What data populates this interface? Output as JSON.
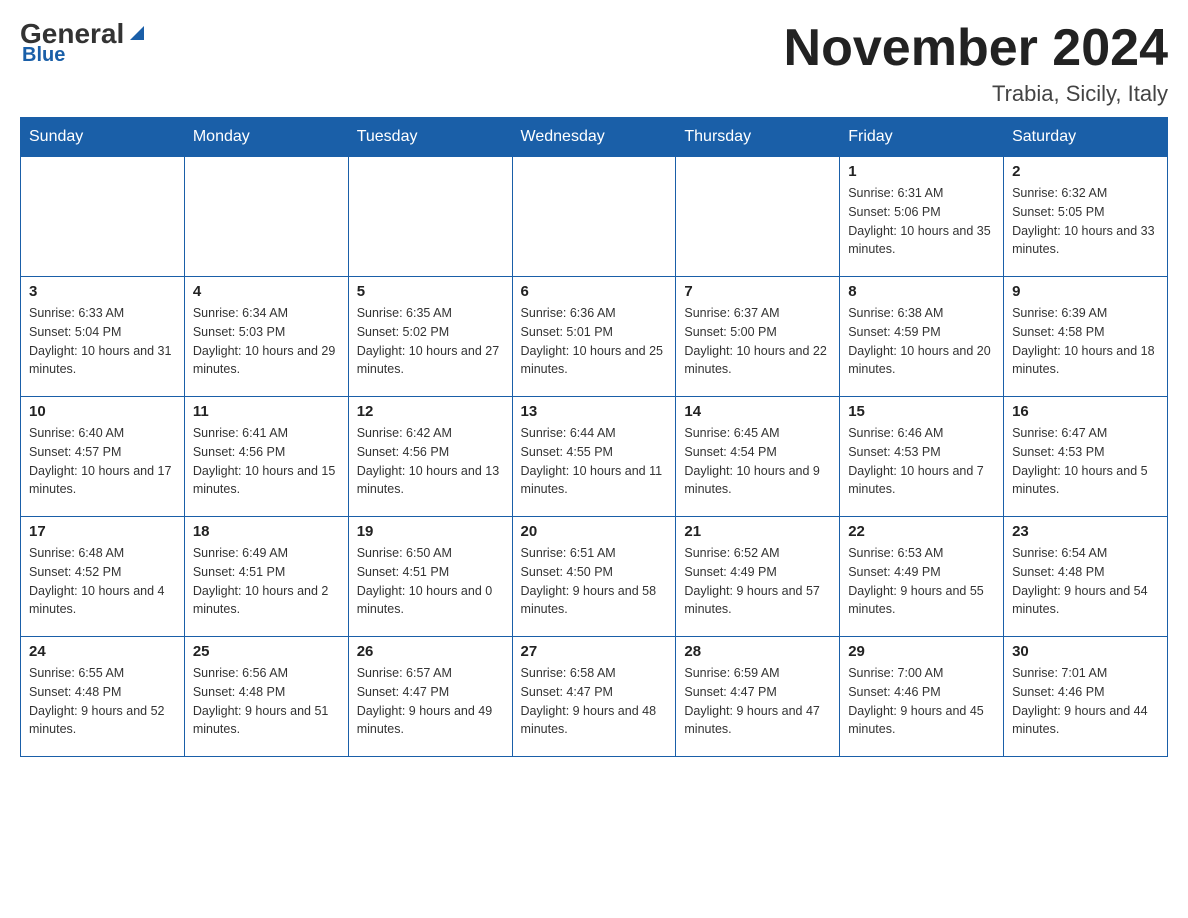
{
  "header": {
    "logo": {
      "text_general": "General",
      "text_blue": "Blue"
    },
    "title": "November 2024",
    "location": "Trabia, Sicily, Italy"
  },
  "weekdays": [
    "Sunday",
    "Monday",
    "Tuesday",
    "Wednesday",
    "Thursday",
    "Friday",
    "Saturday"
  ],
  "weeks": [
    [
      {
        "day": "",
        "info": ""
      },
      {
        "day": "",
        "info": ""
      },
      {
        "day": "",
        "info": ""
      },
      {
        "day": "",
        "info": ""
      },
      {
        "day": "",
        "info": ""
      },
      {
        "day": "1",
        "info": "Sunrise: 6:31 AM\nSunset: 5:06 PM\nDaylight: 10 hours and 35 minutes."
      },
      {
        "day": "2",
        "info": "Sunrise: 6:32 AM\nSunset: 5:05 PM\nDaylight: 10 hours and 33 minutes."
      }
    ],
    [
      {
        "day": "3",
        "info": "Sunrise: 6:33 AM\nSunset: 5:04 PM\nDaylight: 10 hours and 31 minutes."
      },
      {
        "day": "4",
        "info": "Sunrise: 6:34 AM\nSunset: 5:03 PM\nDaylight: 10 hours and 29 minutes."
      },
      {
        "day": "5",
        "info": "Sunrise: 6:35 AM\nSunset: 5:02 PM\nDaylight: 10 hours and 27 minutes."
      },
      {
        "day": "6",
        "info": "Sunrise: 6:36 AM\nSunset: 5:01 PM\nDaylight: 10 hours and 25 minutes."
      },
      {
        "day": "7",
        "info": "Sunrise: 6:37 AM\nSunset: 5:00 PM\nDaylight: 10 hours and 22 minutes."
      },
      {
        "day": "8",
        "info": "Sunrise: 6:38 AM\nSunset: 4:59 PM\nDaylight: 10 hours and 20 minutes."
      },
      {
        "day": "9",
        "info": "Sunrise: 6:39 AM\nSunset: 4:58 PM\nDaylight: 10 hours and 18 minutes."
      }
    ],
    [
      {
        "day": "10",
        "info": "Sunrise: 6:40 AM\nSunset: 4:57 PM\nDaylight: 10 hours and 17 minutes."
      },
      {
        "day": "11",
        "info": "Sunrise: 6:41 AM\nSunset: 4:56 PM\nDaylight: 10 hours and 15 minutes."
      },
      {
        "day": "12",
        "info": "Sunrise: 6:42 AM\nSunset: 4:56 PM\nDaylight: 10 hours and 13 minutes."
      },
      {
        "day": "13",
        "info": "Sunrise: 6:44 AM\nSunset: 4:55 PM\nDaylight: 10 hours and 11 minutes."
      },
      {
        "day": "14",
        "info": "Sunrise: 6:45 AM\nSunset: 4:54 PM\nDaylight: 10 hours and 9 minutes."
      },
      {
        "day": "15",
        "info": "Sunrise: 6:46 AM\nSunset: 4:53 PM\nDaylight: 10 hours and 7 minutes."
      },
      {
        "day": "16",
        "info": "Sunrise: 6:47 AM\nSunset: 4:53 PM\nDaylight: 10 hours and 5 minutes."
      }
    ],
    [
      {
        "day": "17",
        "info": "Sunrise: 6:48 AM\nSunset: 4:52 PM\nDaylight: 10 hours and 4 minutes."
      },
      {
        "day": "18",
        "info": "Sunrise: 6:49 AM\nSunset: 4:51 PM\nDaylight: 10 hours and 2 minutes."
      },
      {
        "day": "19",
        "info": "Sunrise: 6:50 AM\nSunset: 4:51 PM\nDaylight: 10 hours and 0 minutes."
      },
      {
        "day": "20",
        "info": "Sunrise: 6:51 AM\nSunset: 4:50 PM\nDaylight: 9 hours and 58 minutes."
      },
      {
        "day": "21",
        "info": "Sunrise: 6:52 AM\nSunset: 4:49 PM\nDaylight: 9 hours and 57 minutes."
      },
      {
        "day": "22",
        "info": "Sunrise: 6:53 AM\nSunset: 4:49 PM\nDaylight: 9 hours and 55 minutes."
      },
      {
        "day": "23",
        "info": "Sunrise: 6:54 AM\nSunset: 4:48 PM\nDaylight: 9 hours and 54 minutes."
      }
    ],
    [
      {
        "day": "24",
        "info": "Sunrise: 6:55 AM\nSunset: 4:48 PM\nDaylight: 9 hours and 52 minutes."
      },
      {
        "day": "25",
        "info": "Sunrise: 6:56 AM\nSunset: 4:48 PM\nDaylight: 9 hours and 51 minutes."
      },
      {
        "day": "26",
        "info": "Sunrise: 6:57 AM\nSunset: 4:47 PM\nDaylight: 9 hours and 49 minutes."
      },
      {
        "day": "27",
        "info": "Sunrise: 6:58 AM\nSunset: 4:47 PM\nDaylight: 9 hours and 48 minutes."
      },
      {
        "day": "28",
        "info": "Sunrise: 6:59 AM\nSunset: 4:47 PM\nDaylight: 9 hours and 47 minutes."
      },
      {
        "day": "29",
        "info": "Sunrise: 7:00 AM\nSunset: 4:46 PM\nDaylight: 9 hours and 45 minutes."
      },
      {
        "day": "30",
        "info": "Sunrise: 7:01 AM\nSunset: 4:46 PM\nDaylight: 9 hours and 44 minutes."
      }
    ]
  ]
}
